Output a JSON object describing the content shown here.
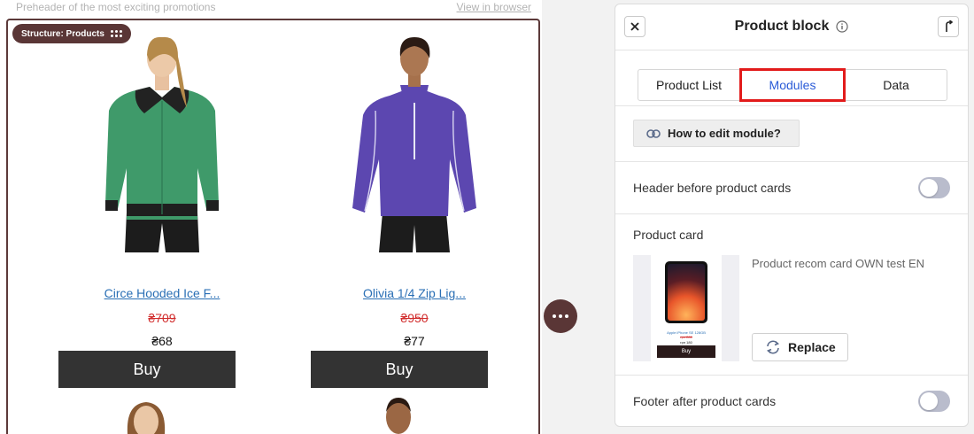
{
  "preheader": {
    "text": "Preheader of the most exciting promotions",
    "view_link": "View in browser"
  },
  "structure": {
    "label": "Structure: Products"
  },
  "products": [
    {
      "name": "Circe Hooded Ice F...",
      "old_price": "₴709",
      "new_price": "₴68",
      "buy_label": "Buy",
      "shirt_color": "#3f9a6a"
    },
    {
      "name": "Olivia 1/4 Zip Lig...",
      "old_price": "₴950",
      "new_price": "₴77",
      "buy_label": "Buy",
      "shirt_color": "#5c47b0"
    }
  ],
  "panel": {
    "title": "Product block",
    "tabs": [
      "Product List",
      "Modules",
      "Data"
    ],
    "active_tab": "Modules",
    "help_button": "How to edit module?",
    "header_toggle_label": "Header before product cards",
    "product_card_label": "Product card",
    "card_name": "Product recom card OWN test EN",
    "thumb": {
      "name": "Apple iPhone SE 128GB",
      "old_price": "грн 280",
      "new_price": "грн 180",
      "buy_label": "Buy"
    },
    "replace_button": "Replace",
    "footer_toggle_label": "Footer after product cards"
  },
  "colors": {
    "accent_brown": "#5a3636",
    "link_blue": "#2a6fb5",
    "price_red": "#d12c2c",
    "tab_highlight": "#e21b1b"
  }
}
